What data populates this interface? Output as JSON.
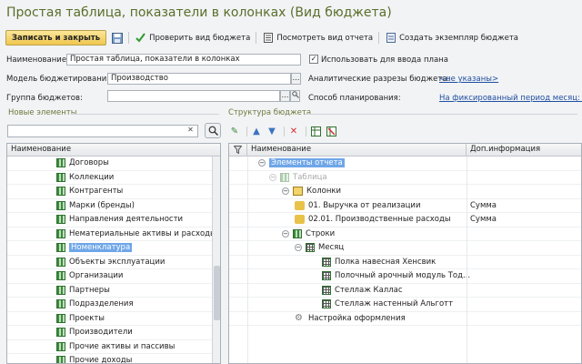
{
  "window": {
    "title": "Простая таблица, показатели в колонках (Вид бюджета)"
  },
  "toolbar": {
    "save_close": "Записать и закрыть",
    "check": "Проверить вид бюджета",
    "view_report": "Посмотреть вид отчета",
    "create_instance": "Создать экземпляр бюджета"
  },
  "form": {
    "name_label": "Наименование:",
    "name_value": "Простая таблица, показатели в колонках",
    "use_for_plan": "Использовать для ввода плана",
    "model_label": "Модель бюджетирования:",
    "model_value": "Производство",
    "analytics_label": "Аналитические разрезы бюджета:",
    "analytics_value": "<не указаны>",
    "group_label": "Группа бюджетов:",
    "group_value": "",
    "method_label": "Способ планирования:",
    "method_value": "На фиксированный период месяц: гр"
  },
  "left": {
    "header": "Новые элементы",
    "search_value": "",
    "col_name": "Наименование",
    "items": [
      "Договоры",
      "Коллекции",
      "Контрагенты",
      "Марки (бренды)",
      "Направления деятельности",
      "Нематериальные активы и расходы н",
      "Номенклатура",
      "Объекты эксплуатации",
      "Организации",
      "Партнеры",
      "Подразделения",
      "Проекты",
      "Производители",
      "Прочие активы и пассивы",
      "Прочие доходы"
    ],
    "selected_index": 6
  },
  "right": {
    "header": "Структура бюджета",
    "col_name": "Наименование",
    "col_info": "Доп.информация",
    "rows": [
      {
        "label": "Элементы отчета",
        "info": "",
        "selected": true
      },
      {
        "label": "Таблица",
        "info": ""
      },
      {
        "label": "Колонки",
        "info": ""
      },
      {
        "label": "01. Выручка от реализации",
        "info": "Сумма"
      },
      {
        "label": "02.01. Производственные расходы",
        "info": "Сумма"
      },
      {
        "label": "Строки",
        "info": ""
      },
      {
        "label": "Месяц",
        "info": ""
      },
      {
        "label": "Полка навесная Хенсвик",
        "info": ""
      },
      {
        "label": "Полочный арочный модуль Тод...",
        "info": ""
      },
      {
        "label": "Стеллаж Каллас",
        "info": ""
      },
      {
        "label": "Стеллаж настенный Альготт",
        "info": ""
      },
      {
        "label": "Настройка оформления",
        "info": ""
      }
    ]
  },
  "colors": {
    "accent": "#6fa6e8",
    "title": "#5a6e2a",
    "save_btn": "#f0c74e"
  }
}
